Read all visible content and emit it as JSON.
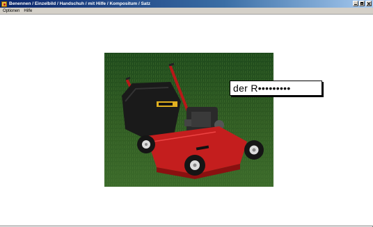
{
  "window": {
    "title": "Benennen / Einzelbild / Handschuh / mit Hilfe / Kompositum / Satz"
  },
  "menu": {
    "items": [
      {
        "label": "Optionen"
      },
      {
        "label": "Hilfe"
      }
    ]
  },
  "exercise": {
    "picture_subject": "red lawn mower on grass",
    "answer_prompt": "der R•••••••••"
  },
  "colors": {
    "titlebar_start": "#0a246a",
    "mower_red": "#c41e1e",
    "grass_green": "#2f5a22"
  }
}
